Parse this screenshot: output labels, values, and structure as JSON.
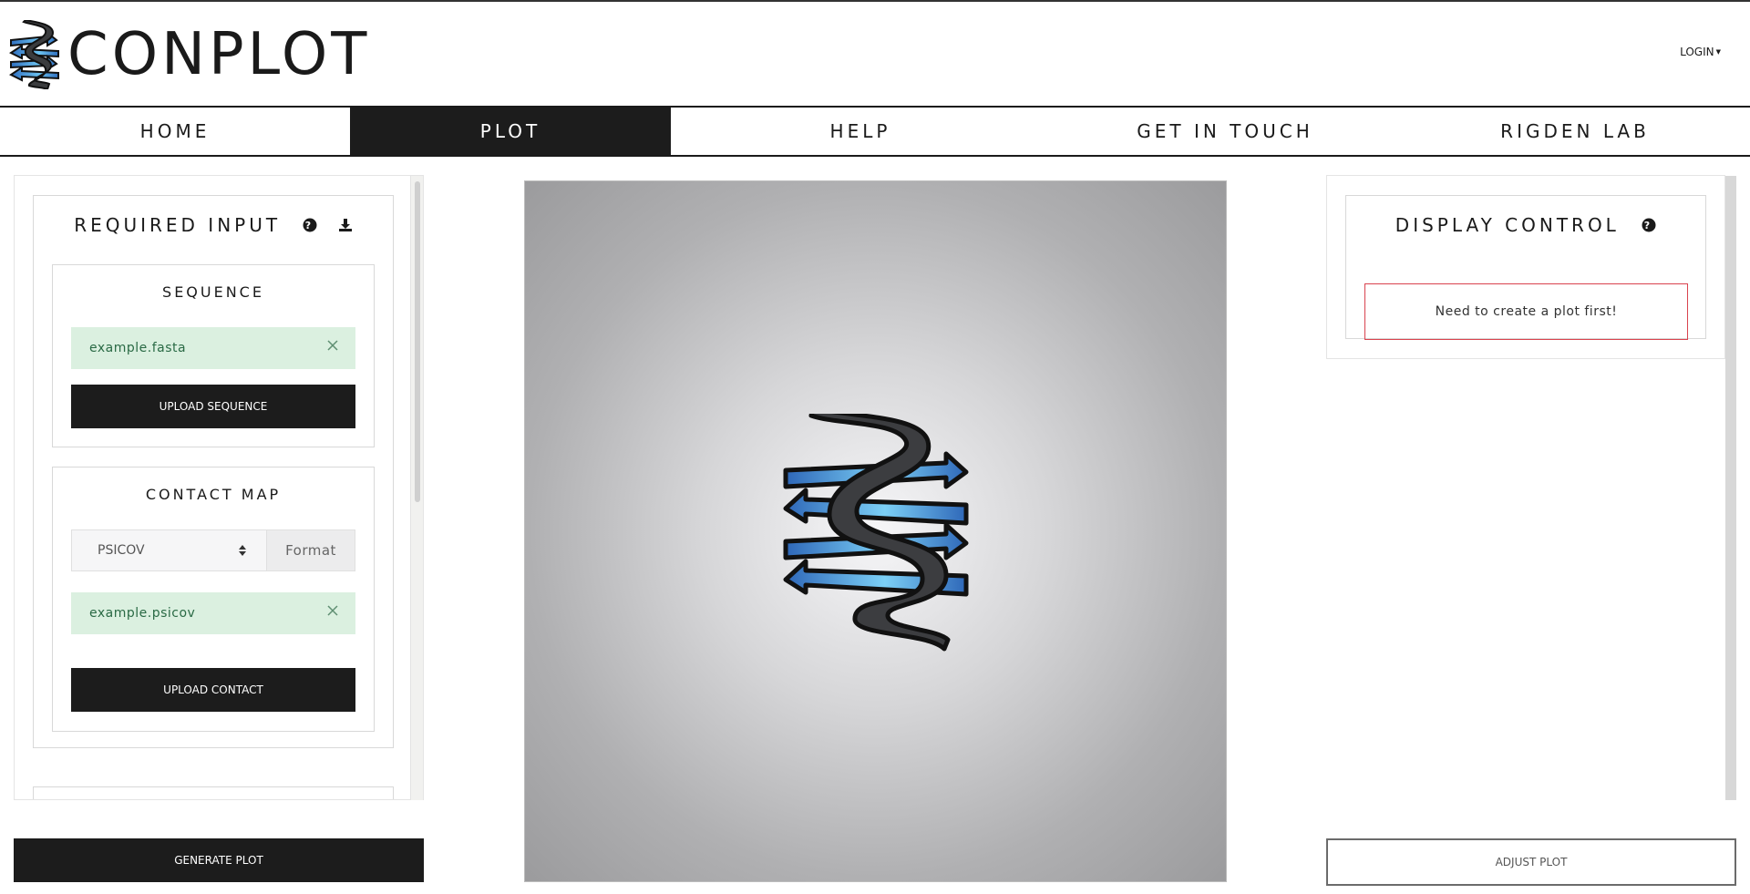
{
  "brand": {
    "name": "CONPLOT",
    "logo_icon": "conplot-helix-logo-icon"
  },
  "header": {
    "login_label": "LOGIN"
  },
  "nav": [
    {
      "label": "HOME",
      "active": false
    },
    {
      "label": "PLOT",
      "active": true
    },
    {
      "label": "HELP",
      "active": false
    },
    {
      "label": "GET IN TOUCH",
      "active": false
    },
    {
      "label": "RIGDEN LAB",
      "active": false
    }
  ],
  "required_input": {
    "title": "REQUIRED INPUT",
    "help_icon": "question-circle-icon",
    "download_icon": "download-icon",
    "sequence": {
      "title": "SEQUENCE",
      "file_name": "example.fasta",
      "upload_label": "UPLOAD SEQUENCE"
    },
    "contact_map": {
      "title": "CONTACT MAP",
      "format_value": "PSICOV",
      "format_addon": "Format",
      "file_name": "example.psicov",
      "upload_label": "UPLOAD CONTACT"
    }
  },
  "display_control": {
    "title": "DISPLAY CONTROL",
    "help_icon": "question-circle-icon",
    "message": "Need to create a plot first!"
  },
  "actions": {
    "generate_label": "GENERATE PLOT",
    "adjust_label": "ADJUST PLOT"
  },
  "colors": {
    "dark": "#1c1c1c",
    "success_bg": "#dbf0e0",
    "success_text": "#2a6a45",
    "warning_border": "#d9434e",
    "helix_blue": "#3f8fdc"
  }
}
